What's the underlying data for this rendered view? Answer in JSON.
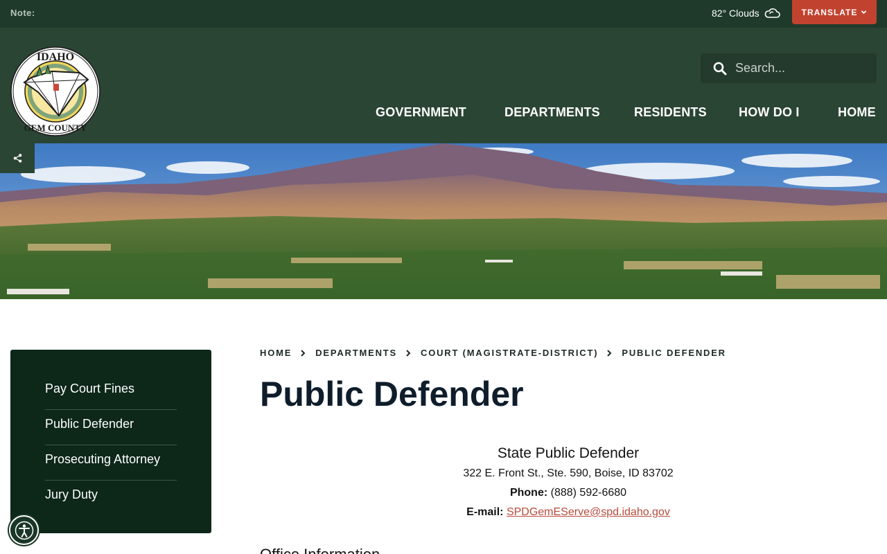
{
  "topbar": {
    "note_label": "Note:",
    "weather": "82° Clouds",
    "translate_label": "TRANSLATE"
  },
  "header": {
    "search_placeholder": "Search...",
    "nav": [
      "GOVERNMENT",
      "DEPARTMENTS",
      "RESIDENTS",
      "HOW DO I",
      "HOME"
    ]
  },
  "sidebar": {
    "items": [
      "Pay Court Fines",
      "Public Defender",
      "Prosecuting Attorney",
      "Jury Duty"
    ]
  },
  "breadcrumb": [
    "HOME",
    "DEPARTMENTS",
    "COURT (MAGISTRATE-DISTRICT)",
    "PUBLIC DEFENDER"
  ],
  "main": {
    "title": "Public Defender",
    "contact": {
      "name": "State Public Defender",
      "address": "322 E. Front St., Ste. 590, Boise, ID 83702",
      "phone_label": "Phone:",
      "phone": "(888) 592-6680",
      "email_label": "E-mail:",
      "email": "SPDGemEServe@spd.idaho.gov"
    },
    "office_heading": "Office Information"
  },
  "logo": {
    "top_text": "IDAHO",
    "bottom_text": "GEM COUNTY"
  },
  "colors": {
    "topbar": "#1f3a2b",
    "header": "#2b4535",
    "sidebar": "#0d2719",
    "accent": "#c1432f",
    "link": "#b84a3a"
  },
  "icons": [
    "cloud-icon",
    "chevron-down-icon",
    "search-icon",
    "share-icon",
    "chevron-right-icon",
    "accessibility-icon"
  ]
}
